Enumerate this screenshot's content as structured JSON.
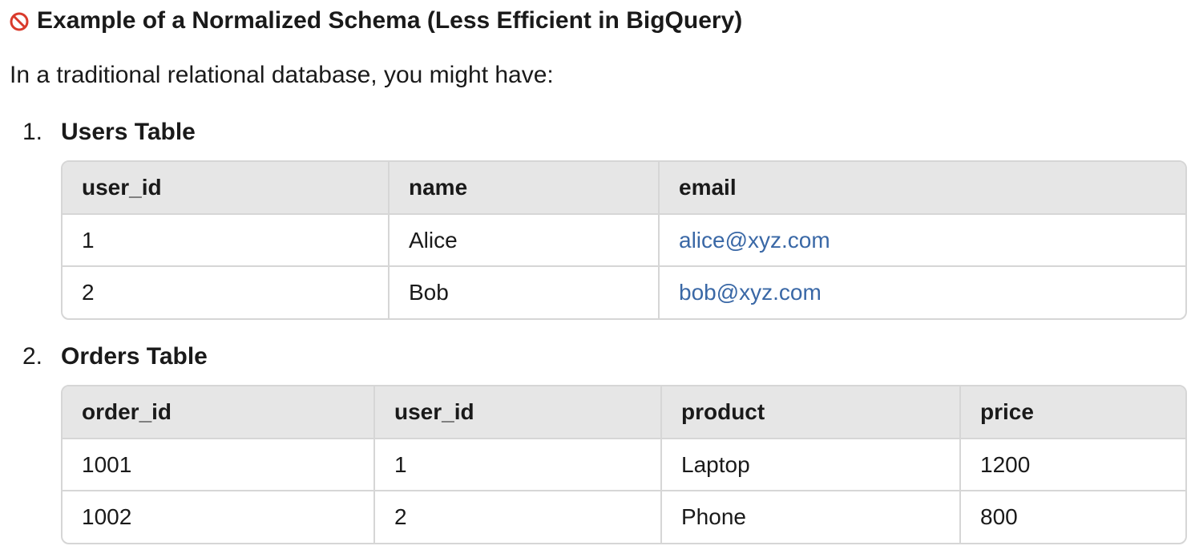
{
  "heading": {
    "icon": "prohibited-icon",
    "text": "Example of a Normalized Schema (Less Efficient in BigQuery)"
  },
  "intro": "In a traditional relational database, you might have:",
  "list": [
    {
      "number": "1.",
      "title": "Users Table",
      "columns": [
        "user_id",
        "name",
        "email"
      ],
      "rows": [
        [
          "1",
          "Alice",
          "alice@xyz.com"
        ],
        [
          "2",
          "Bob",
          "bob@xyz.com"
        ]
      ]
    },
    {
      "number": "2.",
      "title": "Orders Table",
      "columns": [
        "order_id",
        "user_id",
        "product",
        "price"
      ],
      "rows": [
        [
          "1001",
          "1",
          "Laptop",
          "1200"
        ],
        [
          "1002",
          "2",
          "Phone",
          "800"
        ]
      ]
    }
  ],
  "colors": {
    "link": "#3a68a6",
    "header_bg": "#e6e6e6",
    "border": "#d6d6d6",
    "icon_red": "#d93a2b"
  }
}
